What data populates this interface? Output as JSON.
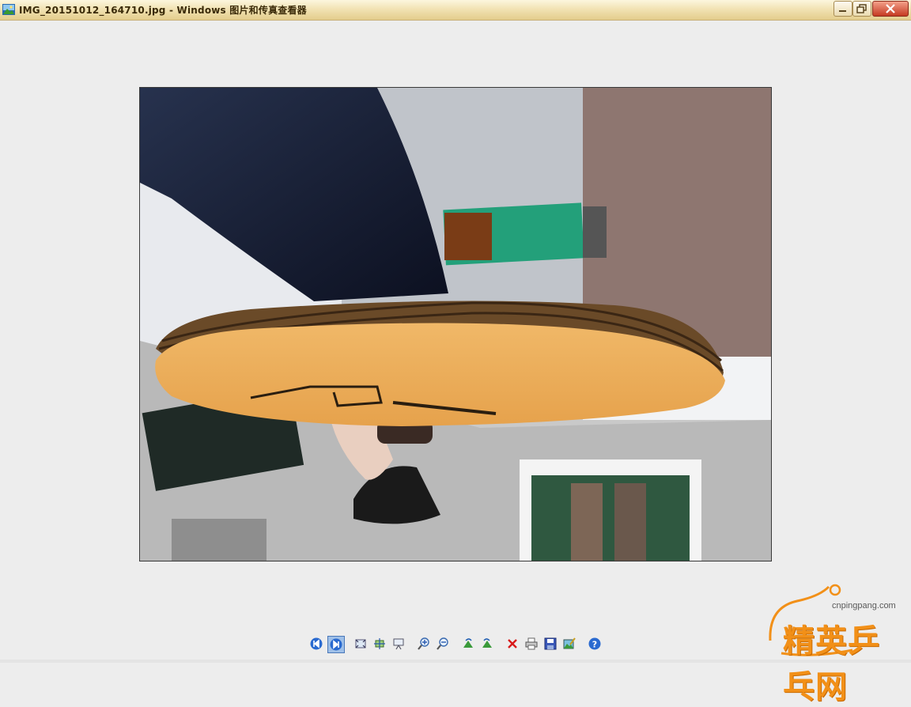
{
  "window": {
    "title": "IMG_20151012_164710.jpg - Windows 图片和传真查看器"
  },
  "photo": {
    "description_label": "photo"
  },
  "toolbar": {
    "buttons": [
      {
        "name": "previous-image-button",
        "icon": "previous-icon"
      },
      {
        "name": "next-image-button",
        "icon": "next-icon"
      },
      {
        "name": "best-fit-button",
        "icon": "best-fit-icon"
      },
      {
        "name": "actual-size-button",
        "icon": "actual-size-icon"
      },
      {
        "name": "slideshow-button",
        "icon": "slideshow-icon"
      },
      {
        "name": "zoom-in-button",
        "icon": "zoom-in-icon"
      },
      {
        "name": "zoom-out-button",
        "icon": "zoom-out-icon"
      },
      {
        "name": "rotate-clockwise-button",
        "icon": "rotate-clockwise-icon"
      },
      {
        "name": "rotate-counterclockwise-button",
        "icon": "rotate-counterclockwise-icon"
      },
      {
        "name": "delete-button",
        "icon": "delete-icon"
      },
      {
        "name": "print-button",
        "icon": "print-icon"
      },
      {
        "name": "copy-to-button",
        "icon": "save-icon"
      },
      {
        "name": "open-editor-button",
        "icon": "edit-icon"
      },
      {
        "name": "help-button",
        "icon": "help-icon"
      }
    ]
  },
  "watermark": {
    "url": "cnpingpang.com",
    "text": "精英乒乓网"
  },
  "colors": {
    "titlebar": "#f2e3b4",
    "background": "#ededed",
    "watermark": "#f29018"
  }
}
